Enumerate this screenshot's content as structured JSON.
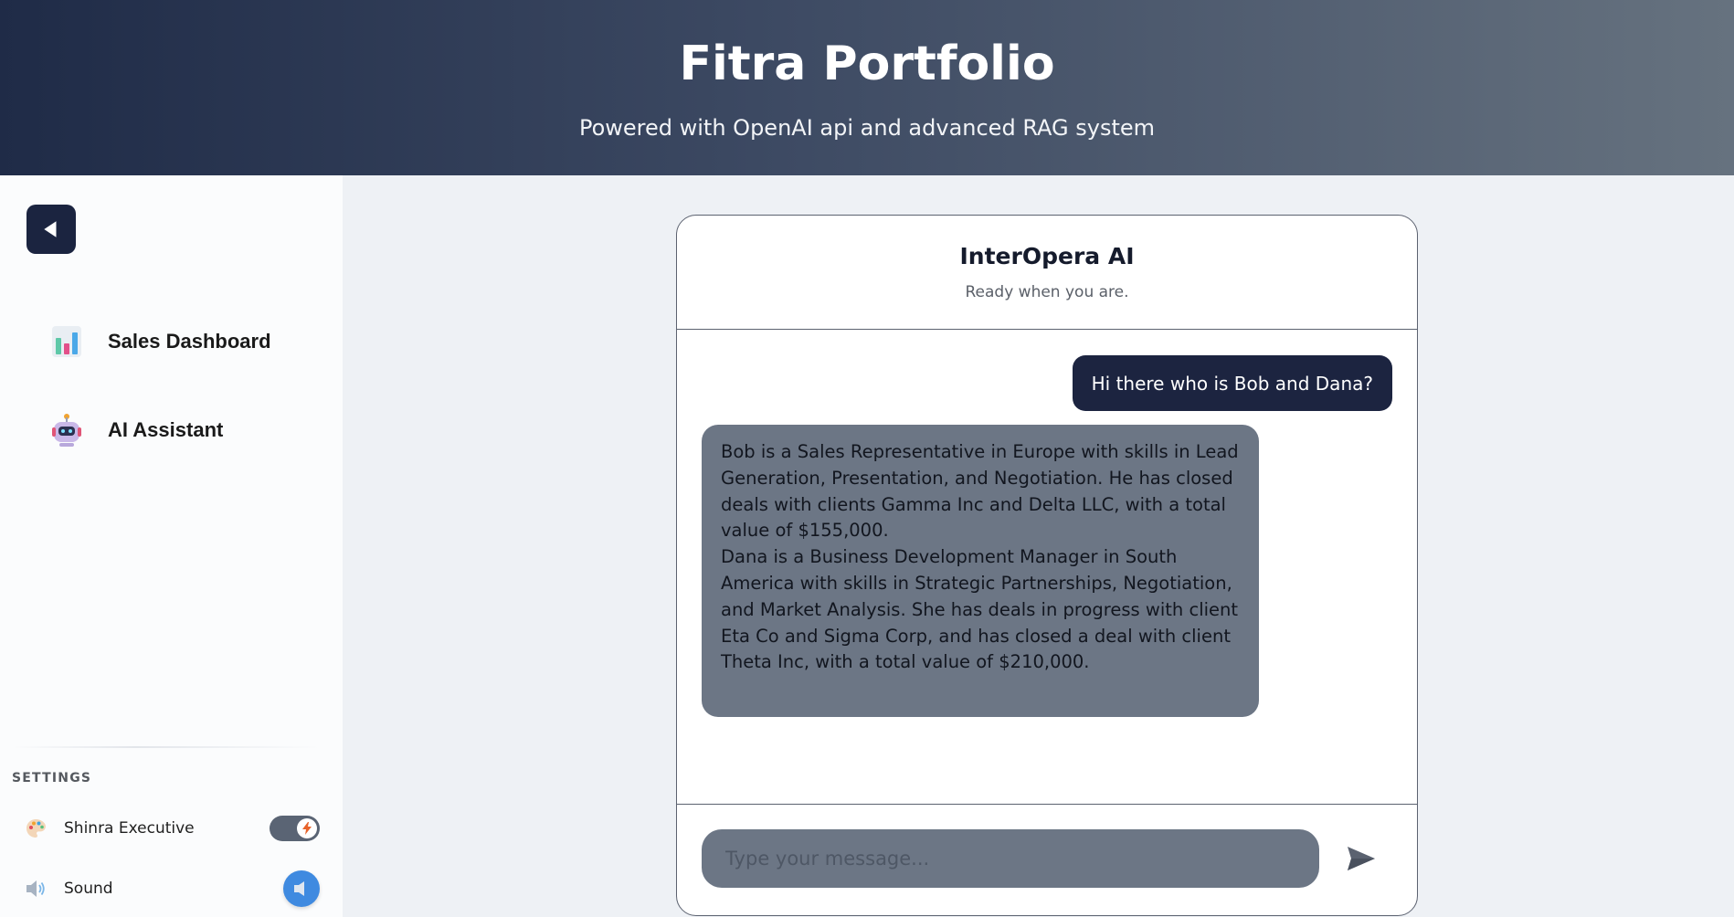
{
  "header": {
    "title": "Fitra Portfolio",
    "subtitle": "Powered with OpenAI api and advanced RAG system"
  },
  "sidebar": {
    "back_icon": "back-arrow-icon",
    "items": [
      {
        "label": "Sales Dashboard",
        "icon": "bar-chart-icon"
      },
      {
        "label": "AI Assistant",
        "icon": "robot-icon"
      }
    ],
    "settings": {
      "title": "SETTINGS",
      "theme": {
        "label": "Shinra Executive",
        "icon": "palette-icon",
        "toggle_on": true
      },
      "sound": {
        "label": "Sound",
        "icon": "speaker-icon"
      }
    }
  },
  "chat": {
    "title": "InterOpera AI",
    "subtitle": "Ready when you are.",
    "messages": [
      {
        "role": "user",
        "text": "Hi there who is Bob and Dana?"
      },
      {
        "role": "assistant",
        "text": "Bob is a Sales Representative in Europe with skills in Lead Generation, Presentation, and Negotiation. He has closed deals with clients Gamma Inc and Delta LLC, with a total value of $155,000.\nDana is a Business Development Manager in South America with skills in Strategic Partnerships, Negotiation, and Market Analysis. She has deals in progress with client Eta Co and Sigma Corp, and has closed a deal with client Theta Inc, with a total value of $210,000."
      }
    ],
    "input": {
      "value": "",
      "placeholder": "Type your message..."
    },
    "send_icon": "send-icon"
  },
  "colors": {
    "header_start": "#1f2b47",
    "header_end": "#66727f",
    "user_bubble": "#1c2440",
    "bot_bubble": "#6c7685",
    "toggle_track": "#5a6474",
    "sound_button": "#3f8ae0"
  }
}
